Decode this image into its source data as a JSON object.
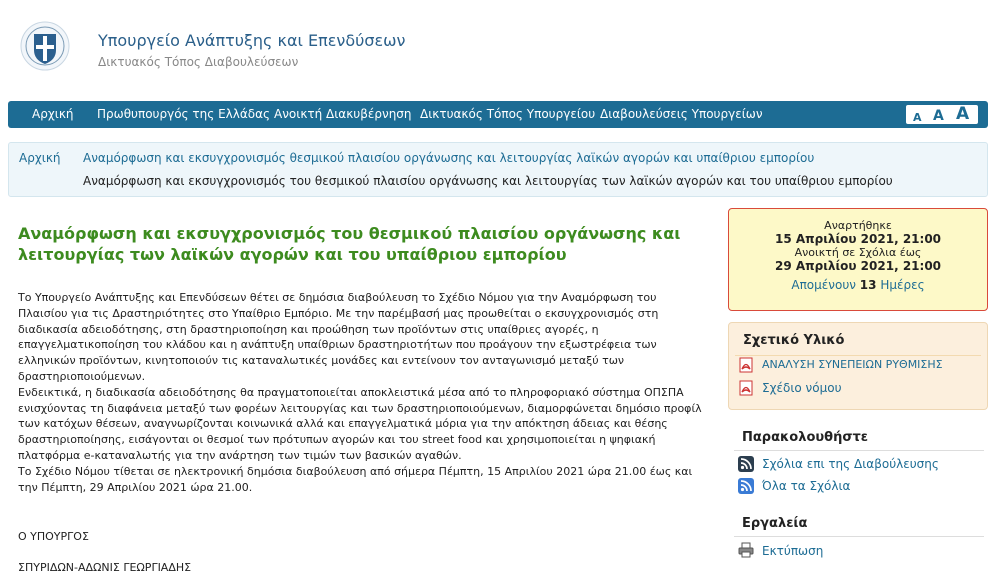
{
  "header": {
    "title": "Υπουργείο Ανάπτυξης και Επενδύσεων",
    "subtitle": "Δικτυακός Τόπος Διαβουλεύσεων"
  },
  "nav": {
    "items": [
      "Αρχική",
      "Πρωθυπουργός της Ελλάδας",
      "Ανοικτή Διακυβέρνηση",
      "Δικτυακός Τόπος Υπουργείου",
      "Διαβουλεύσεις Υπουργείων"
    ],
    "font_sizes": [
      "A",
      "A",
      "A"
    ]
  },
  "breadcrumb": {
    "home": "Αρχική",
    "parent": "Αναμόρφωση και εκσυγχρονισμός θεσμικού πλαισίου οργάνωσης και λειτουργίας λαϊκών αγορών και υπαίθριου εμπορίου",
    "current": "Αναμόρφωση και εκσυγχρονισμός του θεσμικού πλαισίου οργάνωσης και λειτουργίας των λαϊκών αγορών και του υπαίθριου εμπορίου"
  },
  "article": {
    "title": "Αναμόρφωση και εκσυγχρονισμός του θεσμικού πλαισίου οργάνωσης και λειτουργίας των λαϊκών αγορών και του υπαίθριου εμπορίου",
    "para1": "Το Υπουργείο Ανάπτυξης και Επενδύσεων θέτει σε δημόσια διαβούλευση το Σχέδιο Νόμου για την Αναμόρφωση του Πλαισίου για τις Δραστηριότητες στο Υπαίθριο Εμπόριο. Με την παρέμβασή μας προωθείται ο εκσυγχρονισμός στη διαδικασία αδειοδότησης, στη δραστηριοποίηση και προώθηση των προϊόντων στις υπαίθριες αγορές, η επαγγελματικοποίηση του κλάδου και η ανάπτυξη υπαίθριων δραστηριοτήτων που προάγουν την εξωστρέφεια των ελληνικών προϊόντων, κινητοποιούν τις καταναλωτικές μονάδες και εντείνουν τον ανταγωνισμό μεταξύ των δραστηριοποιούμενων.",
    "para2": "Ενδεικτικά, η διαδικασία αδειοδότησης θα πραγματοποιείται αποκλειστικά μέσα από το πληροφοριακό σύστημα ΟΠΣΠΑ ενισχύοντας τη διαφάνεια μεταξύ των φορέων λειτουργίας και των δραστηριοποιούμενων, διαμορφώνεται δημόσιο προφίλ των κατόχων θέσεων, αναγνωρίζονται κοινωνικά αλλά και επαγγελματικά μόρια για την απόκτηση άδειας και θέσης δραστηριοποίησης, εισάγονται οι θεσμοί των πρότυπων αγορών και του street food και χρησιμοποιείται η ψηφιακή πλατφόρμα e-καταναλωτής για την ανάρτηση των τιμών των βασικών αγαθών.",
    "para3": "Το Σχέδιο Νόμου τίθεται σε ηλεκτρονική δημόσια διαβούλευση από σήμερα Πέμπτη, 15 Απριλίου 2021 ώρα 21.00 έως και την Πέμπτη, 29 Απριλίου 2021 ώρα 21.00.",
    "signature_role": "Ο ΥΠΟΥΡΓΟΣ",
    "signature_name": "ΣΠΥΡΙΔΩΝ-ΑΔΩΝΙΣ ΓΕΩΡΓΙΑΔΗΣ"
  },
  "dates": {
    "posted_label": "Αναρτήθηκε",
    "posted_value": "15 Απριλίου 2021, 21:00",
    "open_label": "Ανοικτή σε Σχόλια έως",
    "open_value": "29 Απριλίου 2021, 21:00",
    "remaining_prefix": "Απομένουν",
    "remaining_count": "13",
    "remaining_suffix": "Ημέρες"
  },
  "related": {
    "heading": "Σχετικό Υλικό",
    "items": [
      "ΑΝΑΛΥΣΗ ΣΥΝΕΠΕΙΩΝ ΡΥΘΜΙΣΗΣ",
      "Σχέδιο νόμου"
    ]
  },
  "follow": {
    "heading": "Παρακολουθήστε",
    "items": [
      "Σχόλια επι της Διαβούλευσης",
      "Όλα τα Σχόλια"
    ]
  },
  "tools": {
    "heading": "Εργαλεία",
    "items": [
      "Εκτύπωση"
    ]
  },
  "colors": {
    "brand": "#1d6c94",
    "title_green": "#3d8b1f",
    "date_bg": "#fdf9c8",
    "date_border": "#d94a3a"
  }
}
